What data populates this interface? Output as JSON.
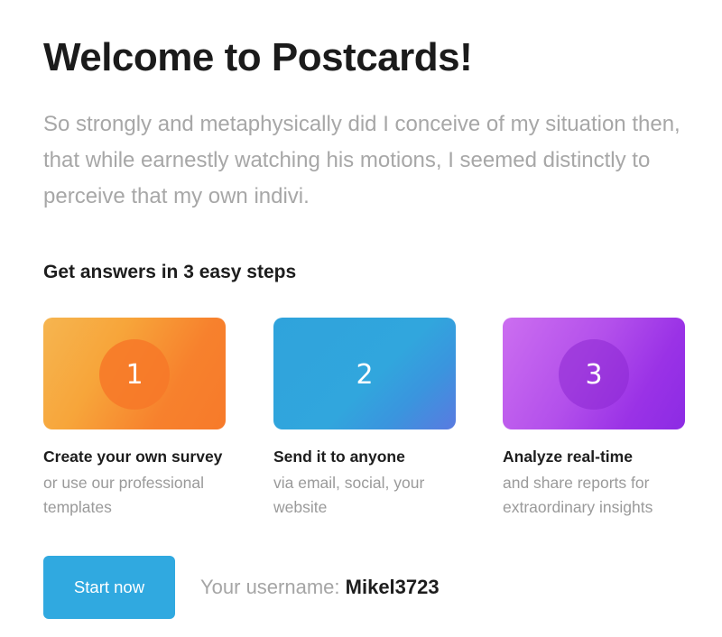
{
  "header": {
    "title": "Welcome to Postcards!",
    "intro": "So strongly and metaphysically did I conceive of my situation then, that while earnestly watching his motions, I seemed distinctly to perceive that my own indivi."
  },
  "steps_section": {
    "heading": "Get answers in 3 easy steps",
    "steps": [
      {
        "number": "1",
        "title": "Create your own survey",
        "description": "or use our professional templates",
        "color": "#f7812d"
      },
      {
        "number": "2",
        "title": "Send it to anyone",
        "description": "via email, social, your website",
        "color": "#30a9e0"
      },
      {
        "number": "3",
        "title": "Analyze real-time",
        "description": "and share reports for extraordinary insights",
        "color": "#9a32e6"
      }
    ]
  },
  "footer": {
    "start_label": "Start now",
    "username_label": "Your username:",
    "username_value": "Mikel3723"
  },
  "colors": {
    "accent": "#30a9e0",
    "title_text": "#1b1b1b",
    "muted_text": "#a7a7a7"
  }
}
